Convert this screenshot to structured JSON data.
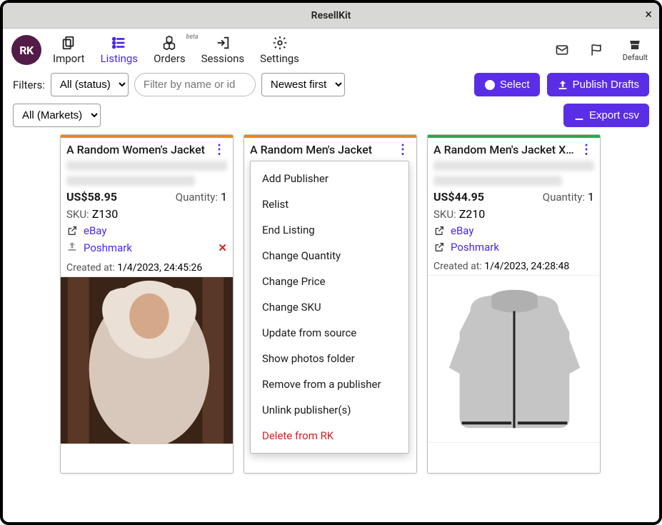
{
  "window": {
    "title": "ResellKit"
  },
  "brand": {
    "badge": "RK"
  },
  "toolbar": {
    "import": "Import",
    "listings": "Listings",
    "orders": "Orders",
    "orders_badge": "beta",
    "sessions": "Sessions",
    "settings": "Settings",
    "default": "Default"
  },
  "filters": {
    "label": "Filters:",
    "status_options": [
      "All (status)"
    ],
    "status_selected": "All (status)",
    "search_placeholder": "Filter by name or id",
    "sort_options": [
      "Newest first"
    ],
    "sort_selected": "Newest first",
    "market_options": [
      "All (Markets)"
    ],
    "market_selected": "All (Markets)"
  },
  "buttons": {
    "select": "Select",
    "publish_drafts": "Publish Drafts",
    "export_csv": "Export csv"
  },
  "context_menu": {
    "items": [
      "Add Publisher",
      "Relist",
      "End Listing",
      "Change Quantity",
      "Change Price",
      "Change SKU",
      "Update from source",
      "Show photos folder",
      "Remove from a publisher",
      "Unlink publisher(s)"
    ],
    "danger": "Delete from RK"
  },
  "cards": [
    {
      "title": "A Random Women's Jacket",
      "price": "US$58.95",
      "quantity_label": "Quantity:",
      "quantity": "1",
      "sku_label": "SKU:",
      "sku": "Z130",
      "markets": [
        {
          "name": "eBay",
          "status": "published"
        },
        {
          "name": "Poshmark",
          "status": "draft"
        }
      ],
      "created_label": "Created at:",
      "created_at": "1/4/2023, 24:45:26",
      "accent": "#e58a1a"
    },
    {
      "title": "A Random Men's Jacket",
      "accent": "#e58a1a"
    },
    {
      "title": "A Random Men's Jacket XXL",
      "price": "US$44.95",
      "quantity_label": "Quantity:",
      "quantity": "1",
      "sku_label": "SKU:",
      "sku": "Z210",
      "markets": [
        {
          "name": "eBay",
          "status": "published"
        },
        {
          "name": "Poshmark",
          "status": "published"
        }
      ],
      "created_label": "Created at:",
      "created_at": "1/4/2023, 24:28:48",
      "accent": "#2aa84f"
    }
  ]
}
